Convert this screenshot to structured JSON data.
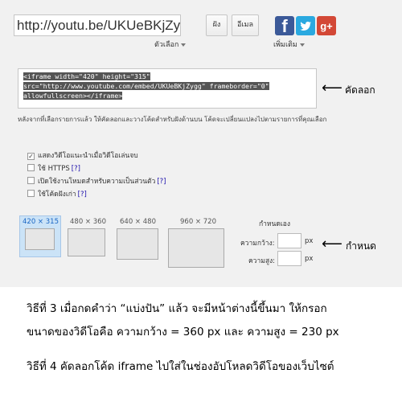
{
  "share": {
    "url": "http://youtu.be/UKUeBKjZyg",
    "options_label": "ตัวเลือก",
    "share_button": "ฝัง",
    "email_button": "อีเมล",
    "more_label": "เพิ่มเติม",
    "social": {
      "facebook": "f",
      "twitter": "t",
      "gplus": "g+"
    }
  },
  "embed": {
    "code_lines": [
      "<iframe width=\"420\" height=\"315\"",
      "src=\"http://www.youtube.com/embed/UKUeBKjZygg\" frameborder=\"0\"",
      "allowfullscreen></iframe>"
    ],
    "hint": "หลังจากที่เลือกรายการแล้ว ให้คัดลอกและวางโค้ดสำหรับฝังด้านบน โค้ดจะเปลี่ยนแปลงไปตามรายการที่คุณเลือก"
  },
  "options": [
    {
      "label": "แสดงวิดีโอแนะนำเมื่อวิดีโอเล่นจบ",
      "checked": true,
      "help": ""
    },
    {
      "label": "ใช้ HTTPS",
      "checked": false,
      "help": "[?]"
    },
    {
      "label": "เปิดใช้งานโหมดสำหรับความเป็นส่วนตัว",
      "checked": false,
      "help": "[?]"
    },
    {
      "label": "ใช้โค้ดฝังเก่า",
      "checked": false,
      "help": "[?]"
    }
  ],
  "sizes": {
    "presets": [
      "420 × 315",
      "480 × 360",
      "640 × 480",
      "960 × 720"
    ],
    "custom_label": "กำหนดเอง",
    "width_label": "ความกว้าง:",
    "height_label": "ความสูง:",
    "unit": "px",
    "width_value": "",
    "height_value": ""
  },
  "annotations": {
    "copy": "คัดลอก",
    "set": "กำหนด"
  },
  "instructions": {
    "line1": "วิธีที่ 3 เมื่อกดคำว่า “แบ่งปัน” แล้ว จะมีหน้าต่างนี้ขึ้นมา ให้กรอก",
    "line2": "ขนาดของวิดีโอคือ  ความกว้าง = 360 px และ ความสูง = 230 px",
    "line3": "วิธีที่ 4 คัดลอกโค้ด iframe ไปใส่ในช่องอัปโหลดวิดีโอของเว็บไซต์"
  },
  "colors": {
    "panel_bg": "#f1f1f1",
    "facebook": "#3b5998",
    "twitter": "#2aa9e0",
    "gplus": "#d34836",
    "selected_preset": "#cbe3f7"
  }
}
